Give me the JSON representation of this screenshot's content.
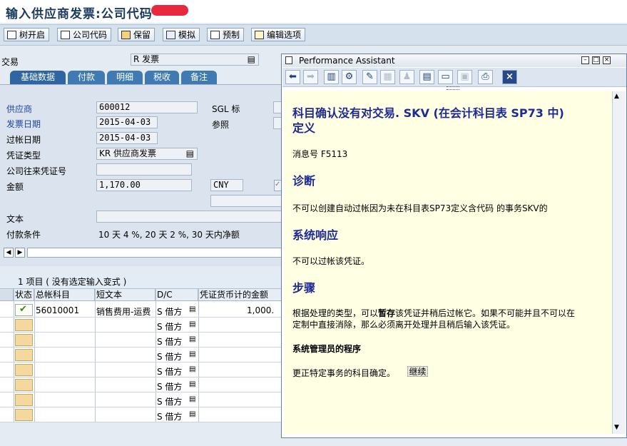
{
  "window": {
    "title": "输入供应商发票:公司代码"
  },
  "toolbar": {
    "tree": "树开启",
    "company_code": "公司代码",
    "hold": "保留",
    "simulate": "模拟",
    "park": "预制",
    "edit_options": "编辑选项"
  },
  "transaction": {
    "label": "交易",
    "value": "R 发票"
  },
  "tabs": [
    "基础数据",
    "付款",
    "明细",
    "税收",
    "备注"
  ],
  "form": {
    "vendor_label": "供应商",
    "vendor_value": "600012",
    "invoice_date_label": "发票日期",
    "invoice_date_value": "2015-04-03",
    "posting_date_label": "过帐日期",
    "posting_date_value": "2015-04-03",
    "doc_type_label": "凭证类型",
    "doc_type_value": "KR 供应商发票",
    "cross_cc_label": "公司往来凭证号",
    "cross_cc_value": "",
    "amount_label": "金额",
    "amount_value": "1,170.00",
    "currency": "CNY",
    "sgl_label": "SGL 标",
    "reference_label": "参照",
    "text_label": "文本",
    "payment_terms_label": "付款条件",
    "payment_terms_value": "10 天 4 %, 20 天 2 %, 30 天内净额"
  },
  "items": {
    "title": "1 项目 ( 没有选定输入变式 )",
    "columns": [
      "状态",
      "总帐科目",
      "短文本",
      "D/C",
      "凭证货币计的金额"
    ],
    "rows": [
      {
        "account": "56010001",
        "text": "销售费用-运费",
        "dc": "S 借方",
        "amount": "1,000."
      },
      {
        "account": "",
        "text": "",
        "dc": "S 借方",
        "amount": ""
      },
      {
        "account": "",
        "text": "",
        "dc": "S 借方",
        "amount": ""
      },
      {
        "account": "",
        "text": "",
        "dc": "S 借方",
        "amount": ""
      },
      {
        "account": "",
        "text": "",
        "dc": "S 借方",
        "amount": ""
      },
      {
        "account": "",
        "text": "",
        "dc": "S 借方",
        "amount": ""
      },
      {
        "account": "",
        "text": "",
        "dc": "S 借方",
        "amount": ""
      },
      {
        "account": "",
        "text": "",
        "dc": "S 借方",
        "amount": ""
      }
    ]
  },
  "pa": {
    "title": "Performance Assistant",
    "heading": "科目确认没有对交易. SKV  (在会计科目表  SP73 中)",
    "heading2": "定义",
    "msg_no": "消息号  F5113",
    "diag_h": "诊断",
    "diag_t": "不可以创建自动过帐因为未在科目表SP73定义含代码  的事务SKV的",
    "sys_h": "系统响应",
    "sys_t": "不可以过帐该凭证。",
    "proc_h": "步骤",
    "proc_t1a": "根据处理的类型，可以",
    "proc_t1b": "暂存",
    "proc_t1c": "该凭证并稍后过帐它。如果不可能并且不可以在",
    "proc_t2": "定制中直接消除，那么必须离开处理并且稍后输入该凭证。",
    "admin_h": "系统管理员的程序",
    "admin_t": "更正特定事务的科目确定。",
    "continue": "继续"
  },
  "colors": {
    "accent": "#1e2a93",
    "tab_bg": "#3f7bb2",
    "pa_bg": "#ffffe4",
    "redaction": "#e8283c"
  }
}
